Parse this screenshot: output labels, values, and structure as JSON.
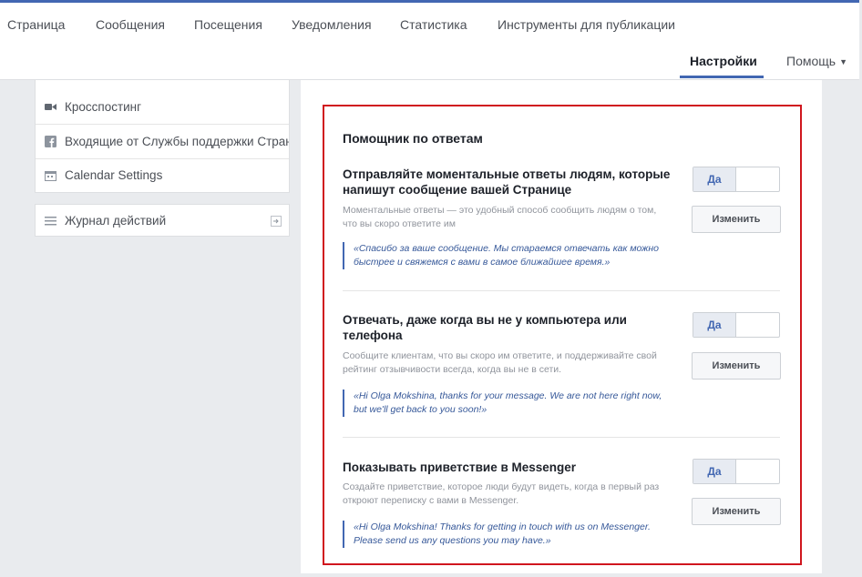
{
  "nav": {
    "tabs": [
      {
        "label": "Страница"
      },
      {
        "label": "Сообщения"
      },
      {
        "label": "Посещения"
      },
      {
        "label": "Уведомления"
      },
      {
        "label": "Статистика"
      },
      {
        "label": "Инструменты для публикации"
      }
    ],
    "settings_label": "Настройки",
    "help_label": "Помощь"
  },
  "sidebar": {
    "items": [
      {
        "label": "Кросспостинг",
        "icon": "video-camera-icon"
      },
      {
        "label": "Входящие от Службы поддержки Страницы",
        "icon": "facebook-icon"
      },
      {
        "label": "Calendar Settings",
        "icon": "calendar-icon"
      }
    ],
    "activity_log": {
      "label": "Журнал действий",
      "icon": "list-icon"
    }
  },
  "main": {
    "title": "Помощник по ответам",
    "sections": [
      {
        "heading": "Отправляйте моментальные ответы людям, которые напишут сообщение вашей Странице",
        "description": "Моментальные ответы — это удобный способ сообщить людям о том, что вы скоро ответите им",
        "quote": "«Спасибо за ваше сообщение. Мы стараемся отвечать как можно быстрее и свяжемся с вами в самое ближайшее время.»",
        "toggle_label": "Да",
        "button_label": "Изменить"
      },
      {
        "heading": "Отвечать, даже когда вы не у компьютера или телефона",
        "description": "Сообщите клиентам, что вы скоро им ответите, и поддерживайте свой рейтинг отзывчивости всегда, когда вы не в сети.",
        "quote": "«Hi Olga Mokshina, thanks for your message. We are not here right now, but we'll get back to you soon!»",
        "toggle_label": "Да",
        "button_label": "Изменить"
      },
      {
        "heading": "Показывать приветствие в Messenger",
        "description": "Создайте приветствие, которое люди будут видеть, когда в первый раз откроют переписку с вами в Messenger.",
        "quote": "«Hi Olga Mokshina! Thanks for getting in touch with us on Messenger. Please send us any questions you may have.»",
        "toggle_label": "Да",
        "button_label": "Изменить"
      }
    ]
  },
  "colors": {
    "accent": "#4267b2",
    "highlight_border": "#d0161e",
    "link": "#365899",
    "muted_text": "#90949c"
  }
}
